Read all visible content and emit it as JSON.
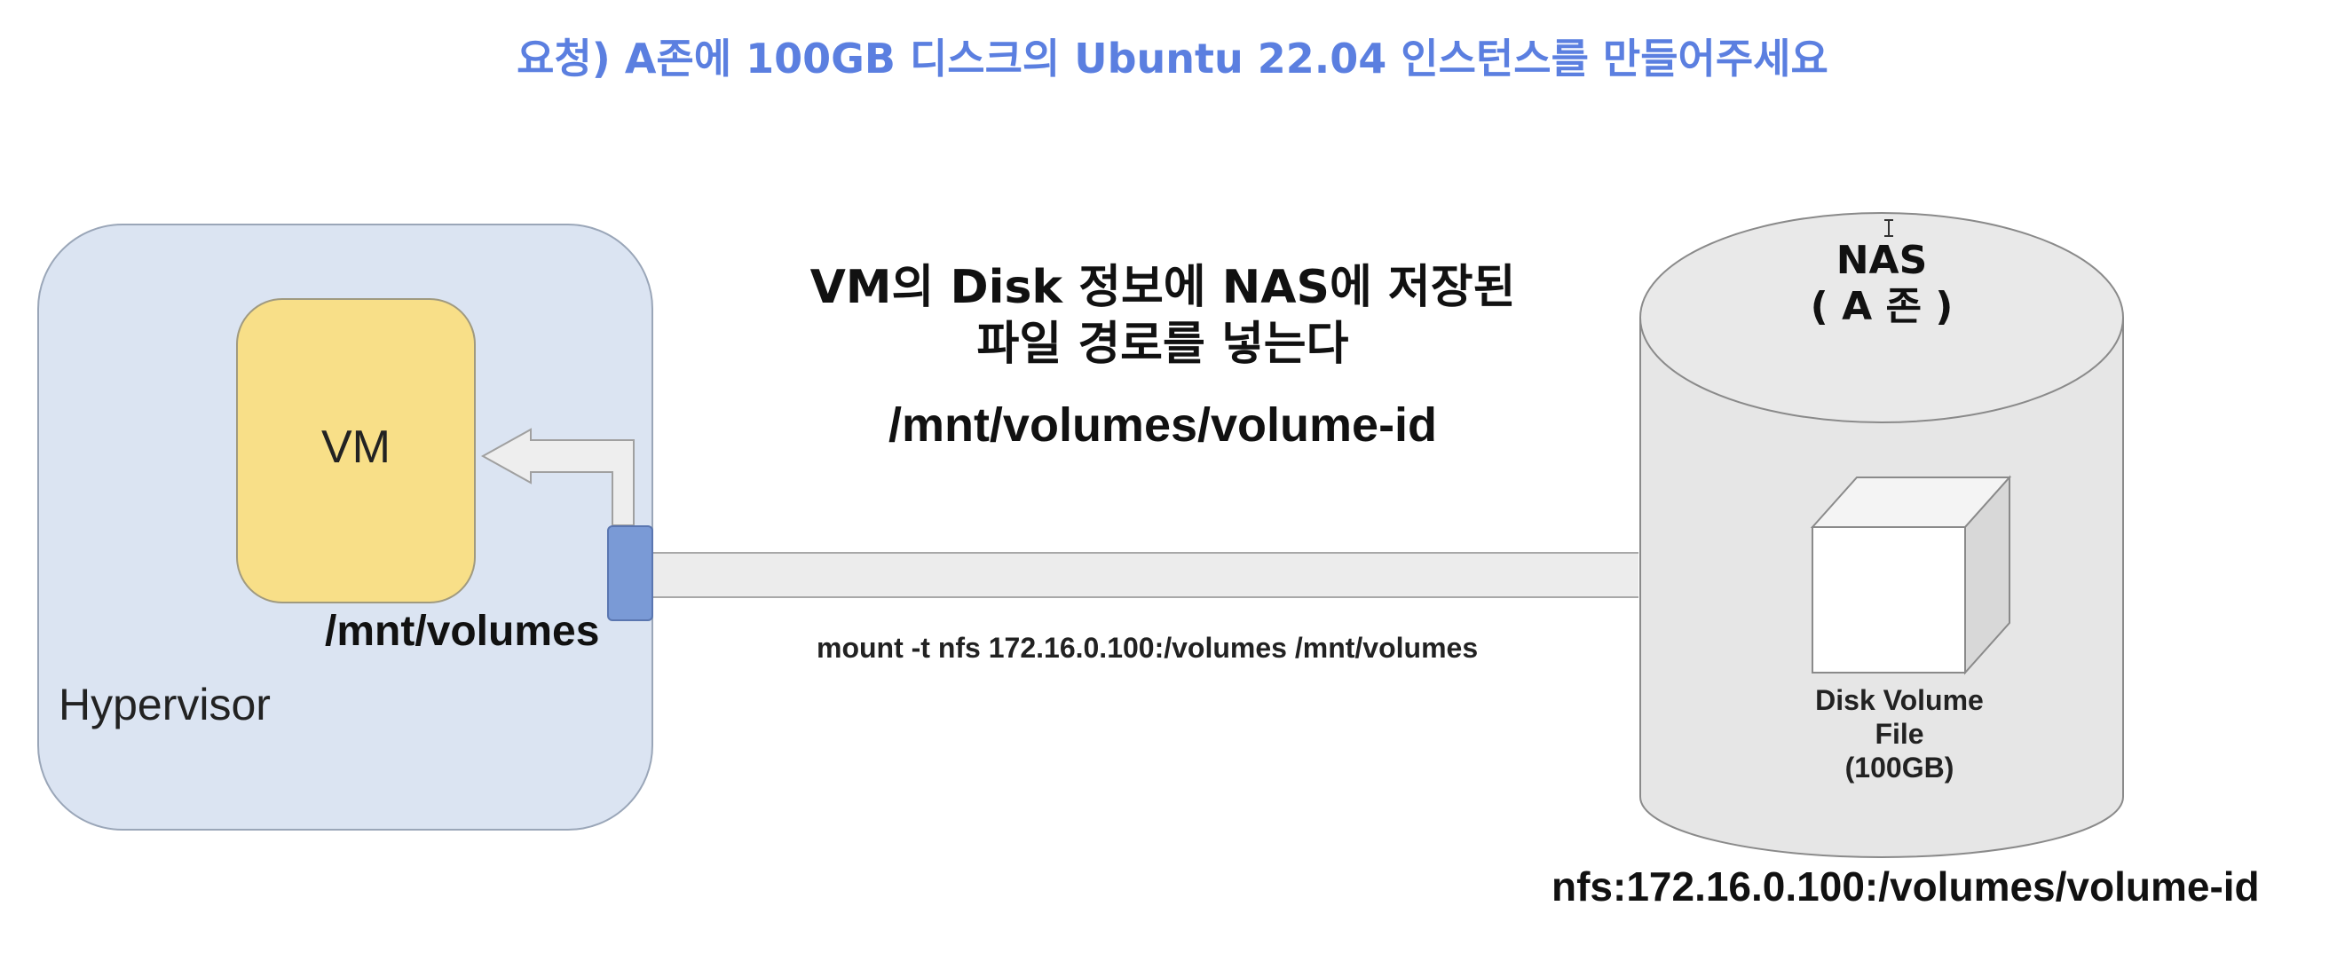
{
  "request": "요청) A존에 100GB 디스크의 Ubuntu 22.04 인스턴스를 만들어주세요",
  "hypervisor": {
    "label": "Hypervisor",
    "vm_label": "VM",
    "mount_point": "/mnt/volumes"
  },
  "description": {
    "line1": "VM의 Disk 정보에 NAS에 저장된",
    "line2": "파일 경로를 넣는다",
    "path": "/mnt/volumes/volume-id"
  },
  "mount_command": "mount -t nfs 172.16.0.100:/volumes /mnt/volumes",
  "nas": {
    "title": "NAS",
    "zone": "( A 존 )",
    "disk_line1": "Disk Volume",
    "disk_line2": "File",
    "disk_line3": "(100GB)",
    "nfs_path": "nfs:172.16.0.100:/volumes/volume-id"
  },
  "colors": {
    "request_text": "#5b7fe0",
    "hypervisor_fill": "#dbe4f2",
    "vm_fill": "#f8df88",
    "port_fill": "#7a9ad6",
    "nas_fill": "#e6e6e6"
  }
}
